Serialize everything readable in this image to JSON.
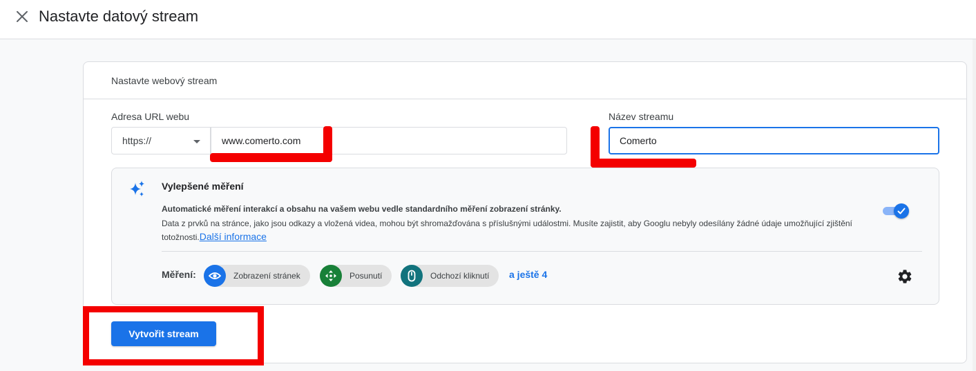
{
  "header": {
    "title": "Nastavte datový stream",
    "close_icon": "close-icon"
  },
  "card": {
    "title": "Nastavte webový stream",
    "url_label": "Adresa URL webu",
    "protocol": {
      "selected": "https://"
    },
    "url_value": "www.comerto.com",
    "stream_name_label": "Název streamu",
    "stream_name_value": "Comerto",
    "enhanced": {
      "icon": "sparkle-icon",
      "title": "Vylepšené měření",
      "desc_bold": "Automatické měření interakcí a obsahu na vašem webu vedle standardního měření zobrazení stránky.",
      "desc": "Data z prvků na stránce, jako jsou odkazy a vložená videa, mohou být shromažďována s příslušnými událostmi. Musíte zajistit, aby Googlu nebyly odesílány žádné údaje umožňující zjištění totožnosti.",
      "learn_more": "Další informace",
      "toggle_on": true,
      "measurement_label": "Měření:",
      "chips": [
        {
          "label": "Zobrazení stránek",
          "icon": "eye-icon",
          "color": "#1a73e8"
        },
        {
          "label": "Posunutí",
          "icon": "move-arrows-icon",
          "color": "#188038"
        },
        {
          "label": "Odchozí kliknutí",
          "icon": "mouse-icon",
          "color": "#12737d"
        }
      ],
      "more": "a ještě 4",
      "settings_icon": "gear-icon"
    },
    "create_button": "Vytvořit stream"
  },
  "colors": {
    "accent": "#1a73e8",
    "annotation": "#f40000"
  }
}
